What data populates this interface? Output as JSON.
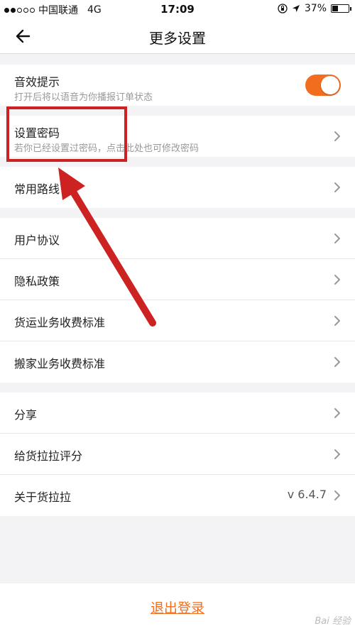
{
  "status_bar": {
    "carrier": "中国联通",
    "network": "4G",
    "time": "17:09",
    "battery": "37%",
    "battery_level": 0.37
  },
  "nav": {
    "title": "更多设置",
    "back_icon": "back-arrow-icon"
  },
  "group_sound": {
    "sound": {
      "title": "音效提示",
      "subtitle": "打开后将以语音为你播报订单状态",
      "toggle_on": true
    }
  },
  "group_password": {
    "password": {
      "title": "设置密码",
      "subtitle": "若你已经设置过密码，点击此处也可修改密码"
    }
  },
  "group_routes": {
    "routes": {
      "title": "常用路线"
    }
  },
  "group_legal": {
    "items": [
      {
        "title": "用户协议"
      },
      {
        "title": "隐私政策"
      },
      {
        "title": "货运业务收费标准"
      },
      {
        "title": "搬家业务收费标准"
      }
    ]
  },
  "group_about": {
    "items": [
      {
        "title": "分享"
      },
      {
        "title": "给货拉拉评分"
      },
      {
        "title": "关于货拉拉",
        "value": "v 6.4.7"
      }
    ]
  },
  "logout": {
    "label": "退出登录"
  },
  "watermark": "Bai 经验",
  "colors": {
    "accent": "#f26e1e",
    "annotation": "#cc2222"
  }
}
